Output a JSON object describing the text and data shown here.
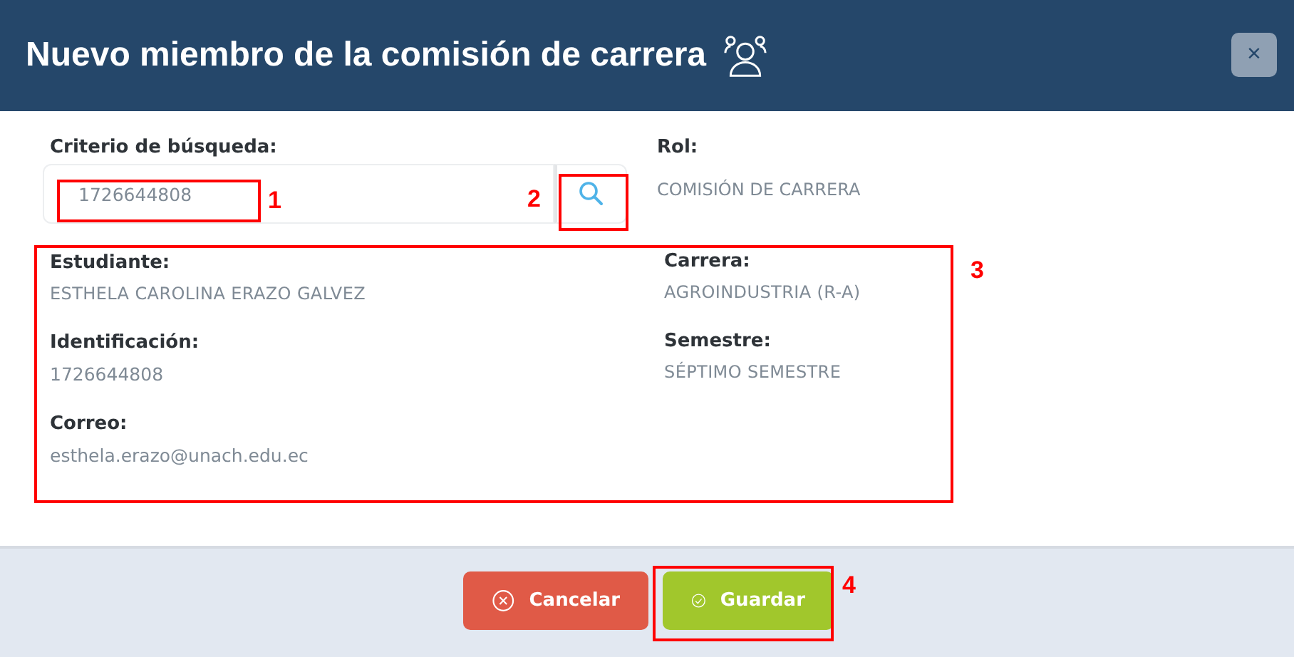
{
  "window": {
    "title": "Nuevo miembro de la comisión de carrera",
    "close": "×"
  },
  "search": {
    "label": "Criterio de búsqueda:",
    "value": "1726644808"
  },
  "role": {
    "label": "Rol:",
    "value": "COMISIÓN DE CARRERA"
  },
  "fields_left": [
    {
      "label": "Estudiante:",
      "value": "ESTHELA CAROLINA ERAZO GALVEZ",
      "kind": "upper"
    },
    {
      "label": "Identificación:",
      "value": "1726644808",
      "kind": "plain"
    },
    {
      "label": "Correo:",
      "value": "esthela.erazo@unach.edu.ec",
      "kind": "plain"
    }
  ],
  "fields_right": [
    {
      "label": "Carrera:",
      "value": "AGROINDUSTRIA (R-A)",
      "kind": "upper"
    },
    {
      "label": "Semestre:",
      "value": "SÉPTIMO SEMESTRE",
      "kind": "upper"
    }
  ],
  "buttons": [
    {
      "label": "Cancelar",
      "kind": "cancel"
    },
    {
      "label": "Guardar",
      "kind": "save"
    }
  ],
  "annotations": [
    {
      "number": "1"
    },
    {
      "number": "2"
    },
    {
      "number": "3"
    },
    {
      "number": "4"
    }
  ]
}
